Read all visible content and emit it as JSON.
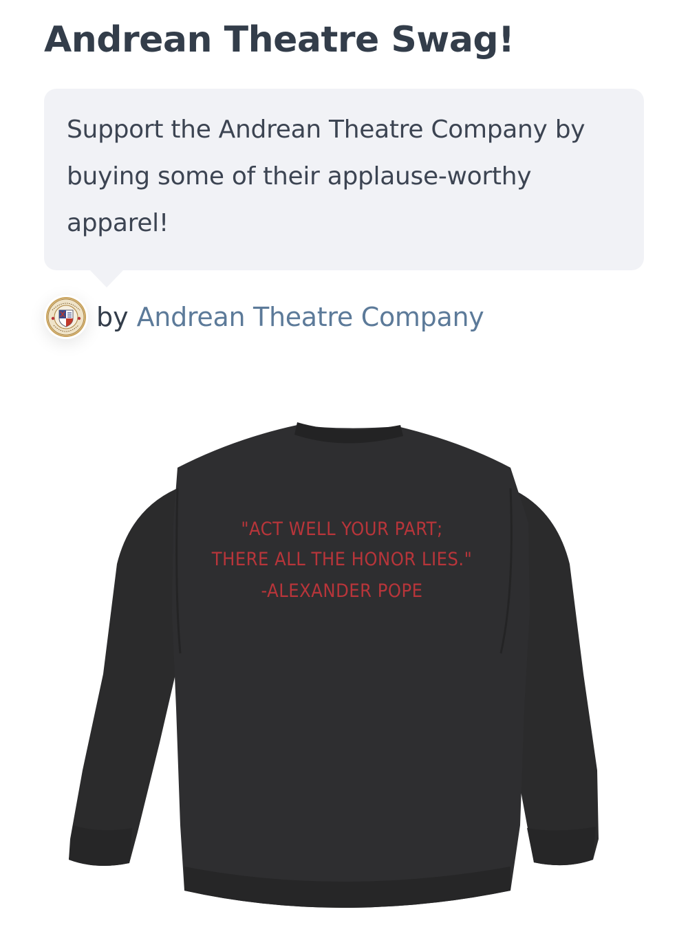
{
  "page": {
    "title": "Andrean Theatre Swag!"
  },
  "description": {
    "text": "Support the Andrean Theatre Company by buying some of their applause-worthy apparel!"
  },
  "byline": {
    "by_label": "by",
    "creator_name": "Andrean Theatre Company",
    "avatar_icon": "theatre-company-seal-logo"
  },
  "product": {
    "garment_color": "#2b2b2c",
    "print_color": "#b8353a",
    "quote_lines": [
      "\"ACT WELL YOUR PART;",
      "THERE ALL THE HONOR LIES.\"",
      "-ALEXANDER POPE"
    ]
  },
  "colors": {
    "title": "#333d4a",
    "link": "#5c7a99",
    "bubble_bg": "#f1f2f6"
  }
}
